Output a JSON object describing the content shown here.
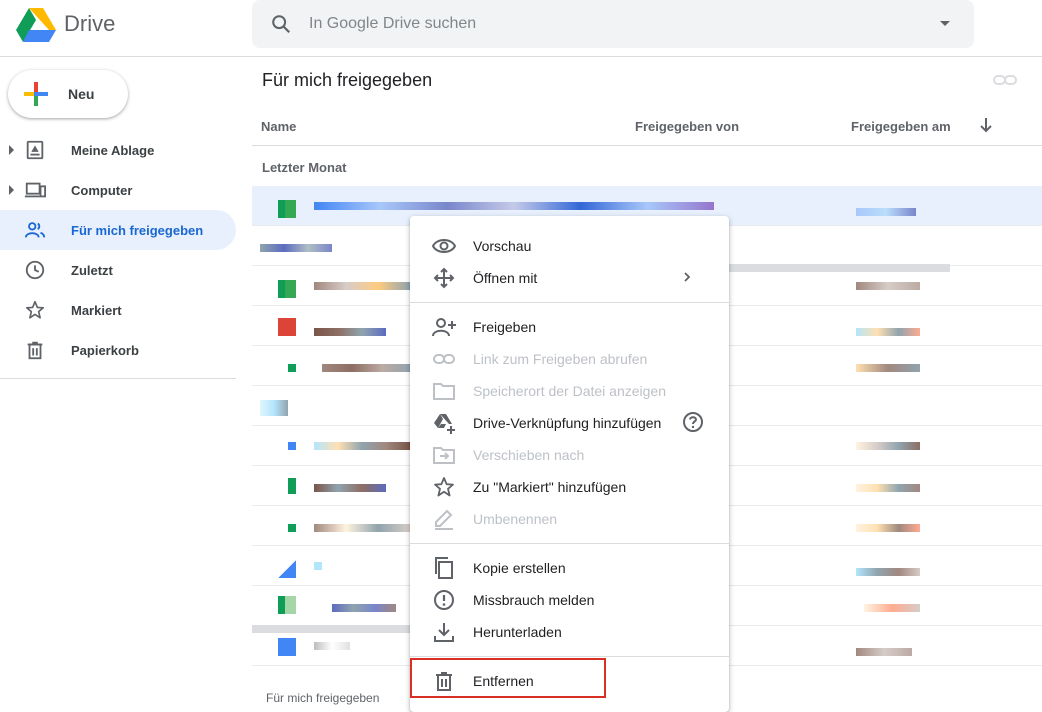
{
  "app": {
    "title": "Drive"
  },
  "search": {
    "placeholder": "In Google Drive suchen"
  },
  "sidebar": {
    "new_button": "Neu",
    "items": [
      {
        "label": "Meine Ablage",
        "icon": "my-drive-icon",
        "expandable": true
      },
      {
        "label": "Computer",
        "icon": "computer-icon",
        "expandable": true
      },
      {
        "label": "Für mich freigegeben",
        "icon": "shared-icon",
        "active": true
      },
      {
        "label": "Zuletzt",
        "icon": "clock-icon"
      },
      {
        "label": "Markiert",
        "icon": "star-icon"
      },
      {
        "label": "Papierkorb",
        "icon": "trash-icon"
      }
    ]
  },
  "main": {
    "title": "Für mich freigegeben",
    "columns": {
      "name": "Name",
      "shared_by": "Freigegeben von",
      "shared_on": "Freigegeben am"
    },
    "group_label": "Letzter Monat",
    "footer": "Für mich freigegeben"
  },
  "context_menu": {
    "items": [
      {
        "label": "Vorschau",
        "icon": "eye-icon",
        "disabled": false
      },
      {
        "label": "Öffnen mit",
        "icon": "move-arrows-icon",
        "disabled": false,
        "submenu": true
      },
      {
        "separator": true
      },
      {
        "label": "Freigeben",
        "icon": "add-person-icon",
        "disabled": false
      },
      {
        "label": "Link zum Freigeben abrufen",
        "icon": "link-icon",
        "disabled": true
      },
      {
        "label": "Speicherort der Datei anzeigen",
        "icon": "folder-icon",
        "disabled": true
      },
      {
        "label": "Drive-Verknüpfung hinzufügen",
        "icon": "drive-shortcut-icon",
        "disabled": false,
        "help": true
      },
      {
        "label": "Verschieben nach",
        "icon": "move-to-icon",
        "disabled": true
      },
      {
        "label": "Zu \"Markiert\" hinzufügen",
        "icon": "star-icon",
        "disabled": false
      },
      {
        "label": "Umbenennen",
        "icon": "pencil-icon",
        "disabled": true
      },
      {
        "separator": true
      },
      {
        "label": "Kopie erstellen",
        "icon": "copy-icon",
        "disabled": false
      },
      {
        "label": "Missbrauch melden",
        "icon": "report-icon",
        "disabled": false
      },
      {
        "label": "Herunterladen",
        "icon": "download-icon",
        "disabled": false
      },
      {
        "separator": true
      },
      {
        "label": "Entfernen",
        "icon": "trash-icon",
        "disabled": false,
        "highlighted": true
      }
    ]
  },
  "colors": {
    "accent": "#1967d2",
    "active_bg": "#e8f0fe",
    "highlight_border": "#d93025"
  }
}
